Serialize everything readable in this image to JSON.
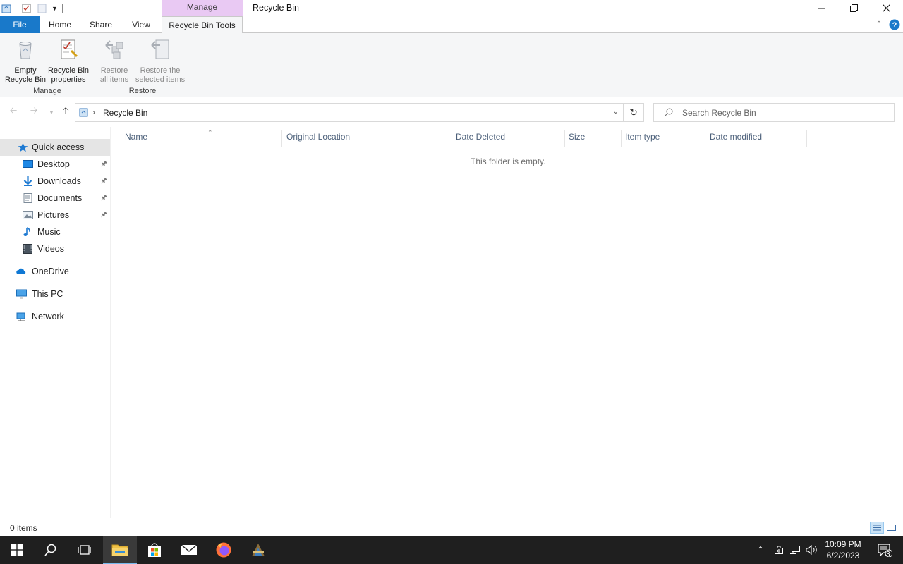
{
  "window": {
    "title": "Recycle Bin",
    "context_tab_header": "Manage"
  },
  "ribbon_tabs": [
    {
      "label": "File"
    },
    {
      "label": "Home"
    },
    {
      "label": "Share"
    },
    {
      "label": "View"
    },
    {
      "label": "Recycle Bin Tools"
    }
  ],
  "ribbon": {
    "manage_group": {
      "label": "Manage",
      "empty_btn": [
        "Empty",
        "Recycle Bin"
      ],
      "props_btn": [
        "Recycle Bin",
        "properties"
      ]
    },
    "restore_group": {
      "label": "Restore",
      "restore_all_btn": [
        "Restore",
        "all items"
      ],
      "restore_selected_btn": [
        "Restore the",
        "selected items"
      ]
    }
  },
  "address": {
    "location": "Recycle Bin",
    "search_placeholder": "Search Recycle Bin"
  },
  "nav": {
    "quick_access": "Quick access",
    "items": [
      "Desktop",
      "Downloads",
      "Documents",
      "Pictures",
      "Music",
      "Videos"
    ],
    "onedrive": "OneDrive",
    "thispc": "This PC",
    "network": "Network"
  },
  "columns": [
    "Name",
    "Original Location",
    "Date Deleted",
    "Size",
    "Item type",
    "Date modified"
  ],
  "empty_message": "This folder is empty.",
  "status": "0 items",
  "clock": {
    "time": "10:09 PM",
    "date": "6/2/2023"
  },
  "notification_count": "3",
  "colors": {
    "file_tab": "#1979ca",
    "context_tab": "#e9c9f3",
    "taskbar": "#1f1f1f"
  }
}
